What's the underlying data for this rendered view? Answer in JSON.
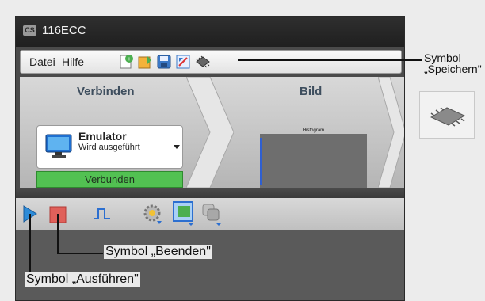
{
  "window": {
    "title": "116ECC",
    "app_icon": "CS"
  },
  "menu": {
    "file": "Datei",
    "help": "Hilfe"
  },
  "toolbar_icons": [
    "new-icon",
    "open-icon",
    "save-icon",
    "edit-icon",
    "chip-icon"
  ],
  "workflow": {
    "connect_title": "Verbinden",
    "device_name": "Emulator",
    "device_status": "Wird ausgeführt",
    "connection_status": "Verbunden",
    "image_title": "Bild",
    "preview_label": "Histogram"
  },
  "run_toolbar_icons": [
    "run-icon",
    "stop-icon",
    "pulse-icon",
    "settings-icon",
    "capture-icon",
    "copy-icon"
  ],
  "annotations": {
    "save_symbol_line1": "Symbol",
    "save_symbol_line2": "„Speichern\"",
    "stop_symbol": "Symbol „Beenden\"",
    "run_symbol": "Symbol „Ausführen\""
  },
  "colors": {
    "connected": "#52c152",
    "accent_blue": "#2f5fd0",
    "stop_red": "#e0605a"
  }
}
